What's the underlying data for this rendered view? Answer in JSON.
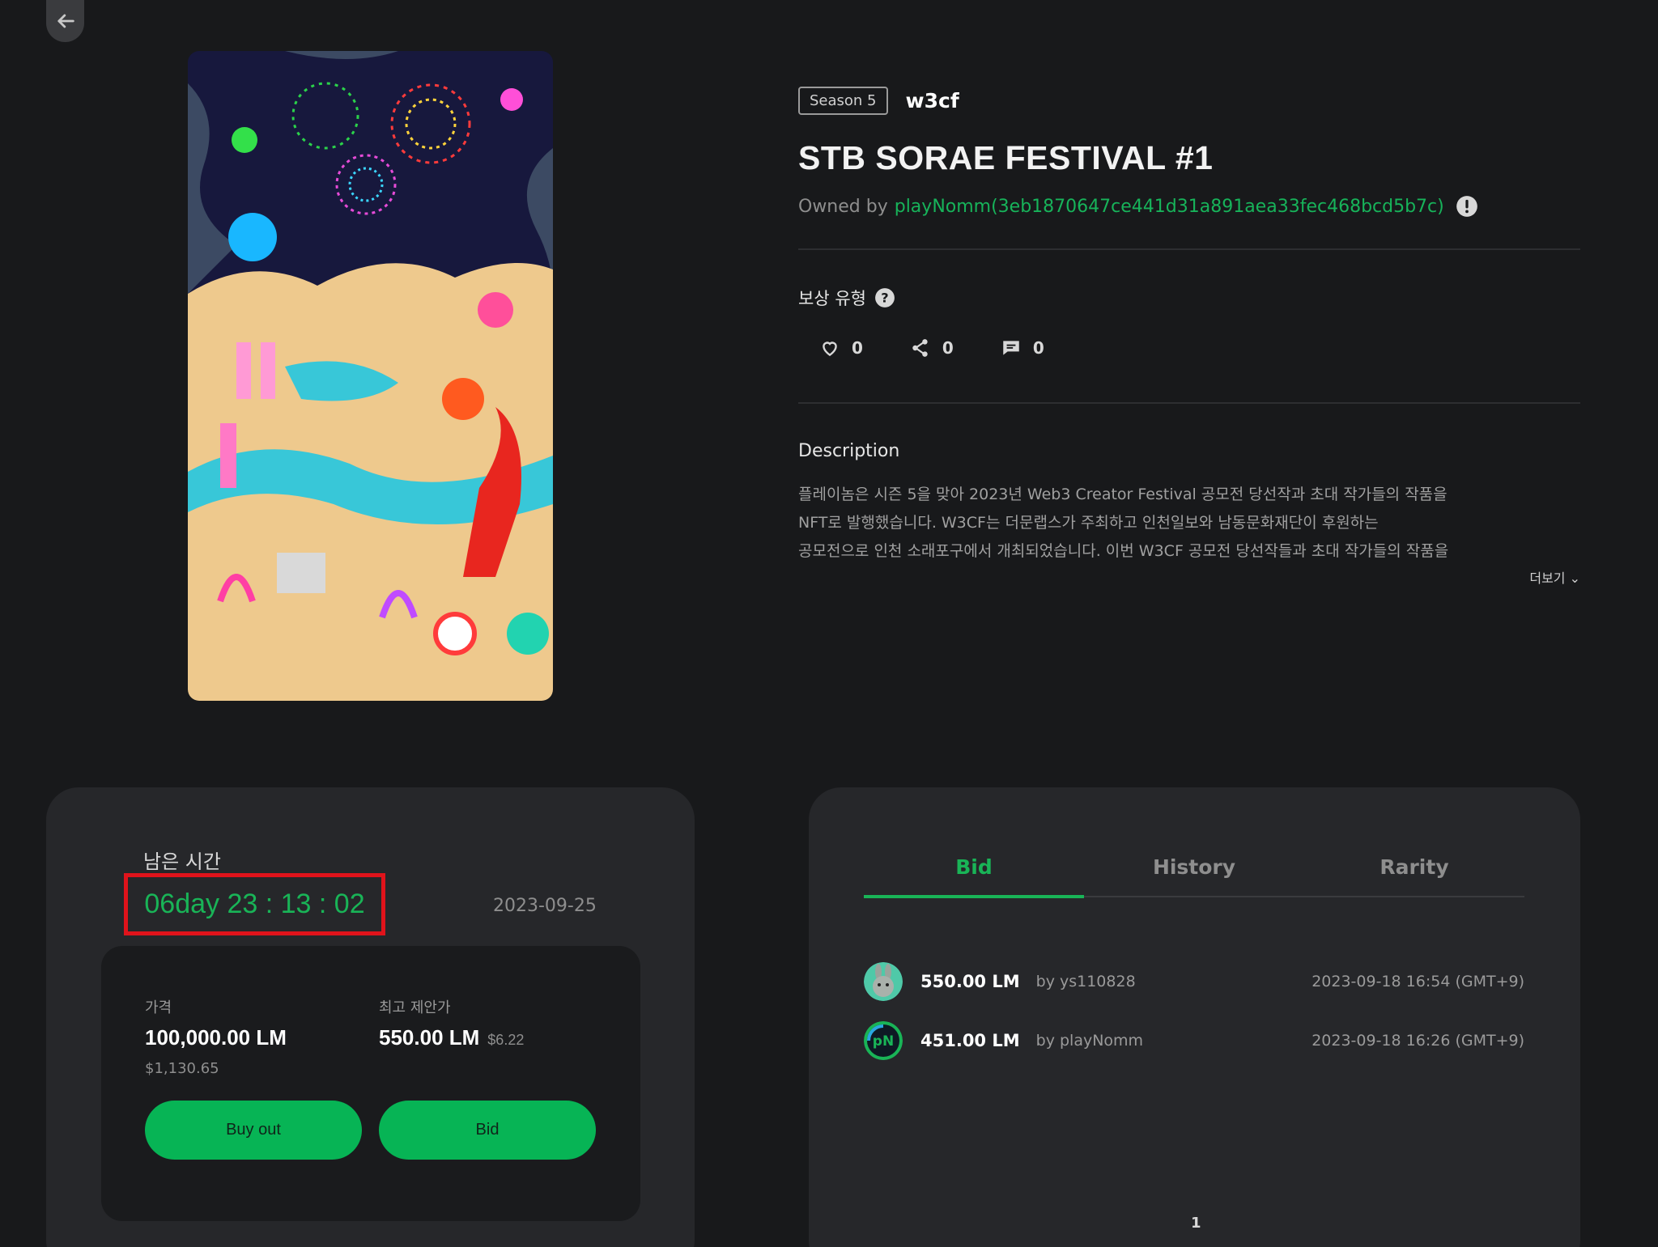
{
  "nav": {
    "back_icon": "arrow-left-icon"
  },
  "item": {
    "season": "Season 5",
    "collection": "w3cf",
    "title": "STB SORAE FESTIVAL #1",
    "owner_prefix": "Owned by",
    "owner_name": "playNomm(3eb1870647ce441d31a891aea33fec468bcd5b7c)",
    "reward_label": "보상 유형",
    "likes": "0",
    "shares": "0",
    "comments": "0",
    "description_title": "Description",
    "description_lines": [
      "플레이놈은 시즌 5을 맞아 2023년 Web3 Creator Festival 공모전 당선작과 초대 작가들의 작품을",
      "NFT로 발행했습니다. W3CF는 더문랩스가 주최하고 인천일보와 남동문화재단이 후원하는",
      "공모전으로 인천 소래포구에서 개최되었습니다. 이번 W3CF 공모전 당선작들과 초대 작가들의 작품을"
    ],
    "more_label": "더보기 ⌄"
  },
  "auction": {
    "remaining_label": "남은 시간",
    "timer": "06day 23 : 13 : 02",
    "end_date": "2023-09-25",
    "price_label": "가격",
    "price_value": "100,000.00 LM",
    "price_usd": "$1,130.65",
    "top_offer_label": "최고 제안가",
    "top_offer_value": "550.00 LM",
    "top_offer_usd": "$6.22",
    "buyout_label": "Buy out",
    "bid_label": "Bid"
  },
  "tabs": [
    {
      "label": "Bid",
      "active": true
    },
    {
      "label": "History",
      "active": false
    },
    {
      "label": "Rarity",
      "active": false
    }
  ],
  "bids": [
    {
      "amount": "550.00 LM",
      "by": "by ys110828",
      "time": "2023-09-18 16:54 (GMT+9)"
    },
    {
      "amount": "451.00 LM",
      "by": "by playNomm",
      "time": "2023-09-18 16:26 (GMT+9)"
    }
  ],
  "pagination": {
    "current": "1"
  },
  "colors": {
    "accent": "#19b457",
    "highlight_border": "#e0131b",
    "background": "#18191b",
    "panel": "#26272a"
  }
}
